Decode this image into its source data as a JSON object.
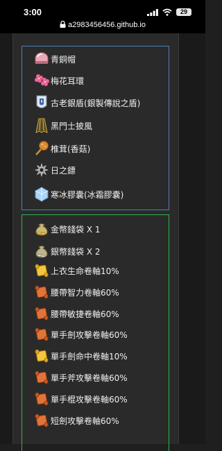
{
  "status_bar": {
    "time": "3:00",
    "battery": "29",
    "icons": [
      "signal-icon",
      "wifi-icon",
      "battery-icon"
    ]
  },
  "browser": {
    "url": "a2983456456.github.io",
    "icons": [
      "lock-icon"
    ]
  },
  "colors": {
    "equipment_border": "#4e7fb8",
    "reward_border": "#2fb548",
    "panel_bg": "#2a2a2a"
  },
  "equipment_list": {
    "items": [
      {
        "icon": "bronze-helmet-icon",
        "label": "青銅帽"
      },
      {
        "icon": "plum-blossom-earring-icon",
        "label": "梅花耳環"
      },
      {
        "icon": "silver-shield-icon",
        "label": "古老銀盾(銀製傳說之盾)"
      },
      {
        "icon": "black-cape-icon",
        "label": "黑門士披風"
      },
      {
        "icon": "mushroom-skewer-icon",
        "label": "椎茸(香菇)"
      },
      {
        "icon": "throwing-star-icon",
        "label": "日之鏢"
      },
      {
        "icon": "ice-capsule-icon",
        "label": "寒冰膠囊(冰霜膠囊)"
      }
    ]
  },
  "reward_list": {
    "items": [
      {
        "icon": "gold-money-bag-icon",
        "label": "金幣錢袋 X 1"
      },
      {
        "icon": "silver-money-bag-icon",
        "label": "銀幣錢袋 X 2"
      },
      {
        "icon": "yellow-scroll-icon",
        "label": "上衣生命卷軸10%"
      },
      {
        "icon": "orange-scroll-icon",
        "label": "腰帶智力卷軸60%"
      },
      {
        "icon": "orange-scroll-icon",
        "label": "腰帶敏捷卷軸60%"
      },
      {
        "icon": "orange-scroll-icon",
        "label": "單手劍攻擊卷軸60%"
      },
      {
        "icon": "yellow-scroll-icon",
        "label": "單手劍命中卷軸10%"
      },
      {
        "icon": "orange-scroll-icon",
        "label": "單手斧攻擊卷軸60%"
      },
      {
        "icon": "orange-scroll-icon",
        "label": "單手棍攻擊卷軸60%"
      },
      {
        "icon": "orange-scroll-icon",
        "label": "短劍攻擊卷軸60%"
      }
    ]
  }
}
